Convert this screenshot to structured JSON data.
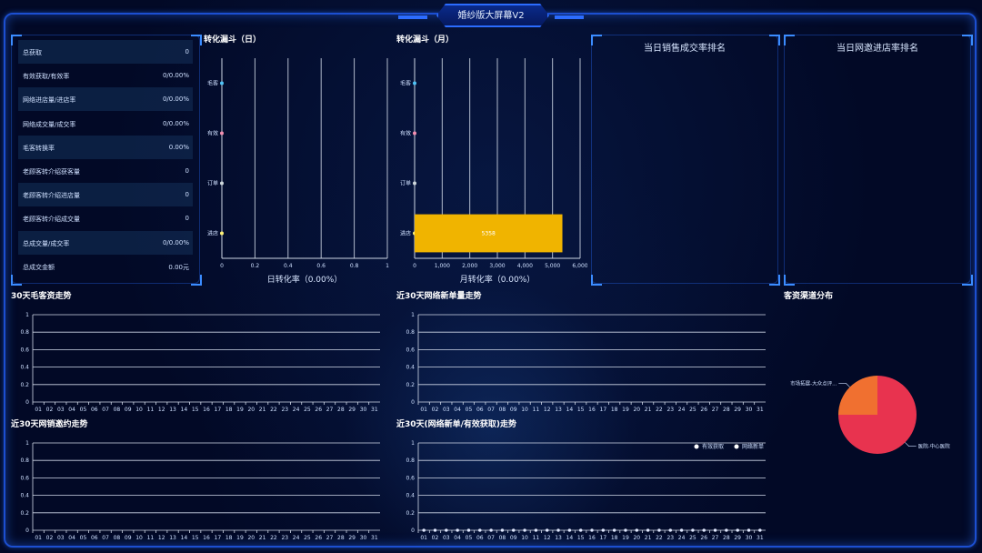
{
  "header": {
    "title": "婚纱版大屏幕V2"
  },
  "stats": [
    {
      "label": "总获取",
      "value": "0"
    },
    {
      "label": "有效获取/有效率",
      "value": "0/0.00%"
    },
    {
      "label": "网络进店量/进店率",
      "value": "0/0.00%"
    },
    {
      "label": "网络成交量/成交率",
      "value": "0/0.00%"
    },
    {
      "label": "毛客转换率",
      "value": "0.00%"
    },
    {
      "label": "老顾客转介绍获客量",
      "value": "0"
    },
    {
      "label": "老顾客转介绍进店量",
      "value": "0"
    },
    {
      "label": "老顾客转介绍成交量",
      "value": "0"
    },
    {
      "label": "总成交量/成交率",
      "value": "0/0.00%"
    },
    {
      "label": "总成交金额",
      "value": "0.00元"
    }
  ],
  "funnel_day": {
    "title": "转化漏斗（日）",
    "rate_label": "日转化率（0.00%）"
  },
  "funnel_month": {
    "title": "转化漏斗（月）",
    "rate_label": "月转化率（0.00%）"
  },
  "rank_sales": {
    "title": "当日销售成交率排名"
  },
  "rank_store": {
    "title": "当日网邀进店率排名"
  },
  "trend_titles": {
    "t1": "30天毛客资走势",
    "t2": "近30天网络新单量走势",
    "t3": "近30天网销邀约走势",
    "t4": "近30天(网络新单/有效获取)走势",
    "t5": "客资渠道分布"
  },
  "colors": {
    "bar": "#f0b400",
    "pie_main": "#e8334f",
    "pie_second": "#f07030",
    "frame": "#1c4fd1"
  },
  "chart_data": [
    {
      "type": "bar",
      "orientation": "horizontal",
      "categories": [
        "毛客",
        "有效",
        "订单",
        "进店"
      ],
      "dot_colors": [
        "#4fc3f7",
        "#f48fb1",
        "#cfd8dc",
        "#fff176"
      ],
      "values": [
        0,
        0,
        0,
        0
      ],
      "xticks": [
        "0",
        "0.2",
        "0.4",
        "0.6",
        "0.8",
        "1"
      ],
      "xlim": [
        0,
        1
      ],
      "title": "转化漏斗（日）"
    },
    {
      "type": "bar",
      "orientation": "horizontal",
      "categories": [
        "毛客",
        "有效",
        "订单",
        "进店"
      ],
      "dot_colors": [
        "#4fc3f7",
        "#f48fb1",
        "#cfd8dc",
        "#fff176"
      ],
      "values": [
        0,
        0,
        0,
        5358
      ],
      "value_label": "5358",
      "xticks": [
        "0",
        "1,000",
        "2,000",
        "3,000",
        "4,000",
        "5,000",
        "6,000"
      ],
      "xlim": [
        0,
        6000
      ],
      "title": "转化漏斗（月）"
    },
    {
      "type": "line",
      "title": "30天毛客资走势",
      "x": [
        "01",
        "02",
        "03",
        "04",
        "05",
        "06",
        "07",
        "08",
        "09",
        "10",
        "11",
        "12",
        "13",
        "14",
        "15",
        "16",
        "17",
        "18",
        "19",
        "20",
        "21",
        "22",
        "23",
        "24",
        "25",
        "26",
        "27",
        "28",
        "29",
        "30",
        "31"
      ],
      "yticks": [
        "0",
        "0.2",
        "0.4",
        "0.6",
        "0.8",
        "1"
      ],
      "ylim": [
        0,
        1
      ],
      "series": []
    },
    {
      "type": "line",
      "title": "近30天网络新单量走势",
      "x": [
        "01",
        "02",
        "03",
        "04",
        "05",
        "06",
        "07",
        "08",
        "09",
        "10",
        "11",
        "12",
        "13",
        "14",
        "15",
        "16",
        "17",
        "18",
        "19",
        "20",
        "21",
        "22",
        "23",
        "24",
        "25",
        "26",
        "27",
        "28",
        "29",
        "30",
        "31"
      ],
      "yticks": [
        "0",
        "0.2",
        "0.4",
        "0.6",
        "0.8",
        "1"
      ],
      "ylim": [
        0,
        1
      ],
      "series": []
    },
    {
      "type": "line",
      "title": "近30天网销邀约走势",
      "x": [
        "01",
        "02",
        "03",
        "04",
        "05",
        "06",
        "07",
        "08",
        "09",
        "10",
        "11",
        "12",
        "13",
        "14",
        "15",
        "16",
        "17",
        "18",
        "19",
        "20",
        "21",
        "22",
        "23",
        "24",
        "25",
        "26",
        "27",
        "28",
        "29",
        "30",
        "31"
      ],
      "yticks": [
        "0",
        "0.2",
        "0.4",
        "0.6",
        "0.8",
        "1"
      ],
      "ylim": [
        0,
        1
      ],
      "series": []
    },
    {
      "type": "line",
      "title": "近30天(网络新单/有效获取)走势",
      "x": [
        "01",
        "02",
        "03",
        "04",
        "05",
        "06",
        "07",
        "08",
        "09",
        "10",
        "11",
        "12",
        "13",
        "14",
        "15",
        "16",
        "17",
        "18",
        "19",
        "20",
        "21",
        "22",
        "23",
        "24",
        "25",
        "26",
        "27",
        "28",
        "29",
        "30",
        "31"
      ],
      "yticks": [
        "0",
        "0.2",
        "0.4",
        "0.6",
        "0.8",
        "1"
      ],
      "ylim": [
        0,
        1
      ],
      "legend": [
        "有效获取",
        "网络新单"
      ],
      "series": [
        {
          "name": "有效获取",
          "values": [
            0,
            0,
            0,
            0,
            0,
            0,
            0,
            0,
            0,
            0,
            0,
            0,
            0,
            0,
            0,
            0,
            0,
            0,
            0,
            0,
            0,
            0,
            0,
            0,
            0,
            0,
            0,
            0,
            0,
            0,
            0
          ]
        },
        {
          "name": "网络新单",
          "values": [
            0,
            0,
            0,
            0,
            0,
            0,
            0,
            0,
            0,
            0,
            0,
            0,
            0,
            0,
            0,
            0,
            0,
            0,
            0,
            0,
            0,
            0,
            0,
            0,
            0,
            0,
            0,
            0,
            0,
            0,
            0
          ]
        }
      ]
    },
    {
      "type": "pie",
      "title": "客资渠道分布",
      "slices": [
        {
          "label": "医院-中心医院",
          "value": 75
        },
        {
          "label": "市场拓展-大众点评...",
          "value": 25
        }
      ]
    }
  ]
}
